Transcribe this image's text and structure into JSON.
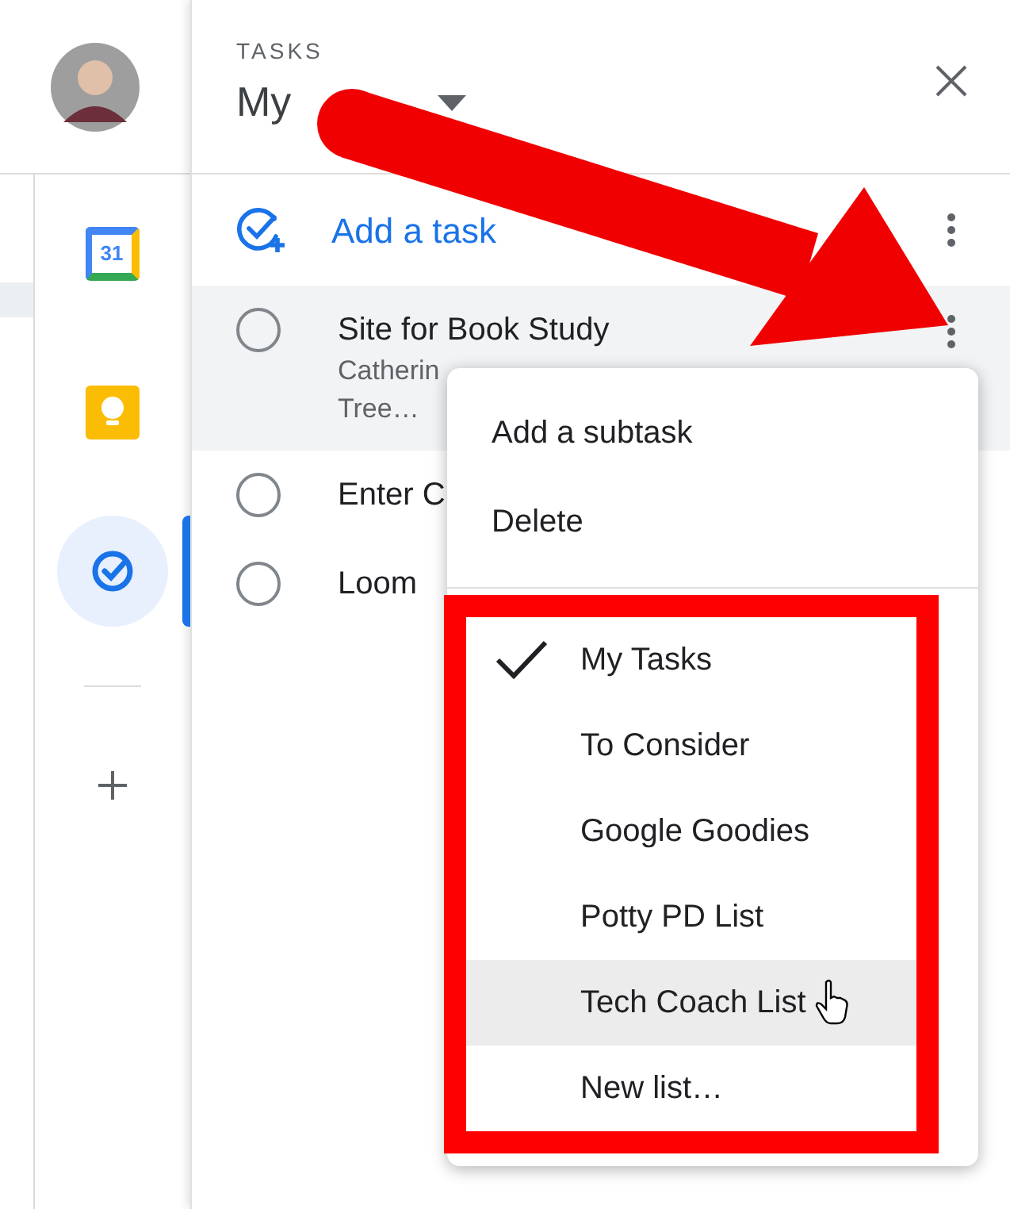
{
  "side_apps": [
    {
      "kind": "calendar",
      "label": "31",
      "selected": false
    },
    {
      "kind": "keep",
      "selected": false
    },
    {
      "kind": "tasks",
      "selected": true
    }
  ],
  "panel": {
    "eyebrow": "TASKS",
    "title": "My"
  },
  "add_task": "Add a task",
  "tasks": [
    {
      "title": "Site for Book Study",
      "notes": [
        "Catherin",
        "Tree…"
      ],
      "hovered": true
    },
    {
      "title": "Enter C",
      "hovered": false
    },
    {
      "title": "Loom",
      "hovered": false
    }
  ],
  "menu": {
    "actions": [
      "Add a subtask",
      "Delete"
    ],
    "lists": [
      {
        "label": "My Tasks",
        "checked": true,
        "hovered": false
      },
      {
        "label": "To Consider",
        "checked": false,
        "hovered": false
      },
      {
        "label": "Google Goodies",
        "checked": false,
        "hovered": false
      },
      {
        "label": "Potty PD List",
        "checked": false,
        "hovered": false
      },
      {
        "label": "Tech Coach List",
        "checked": false,
        "hovered": true
      },
      {
        "label": "New list…",
        "checked": false,
        "hovered": false
      }
    ]
  }
}
